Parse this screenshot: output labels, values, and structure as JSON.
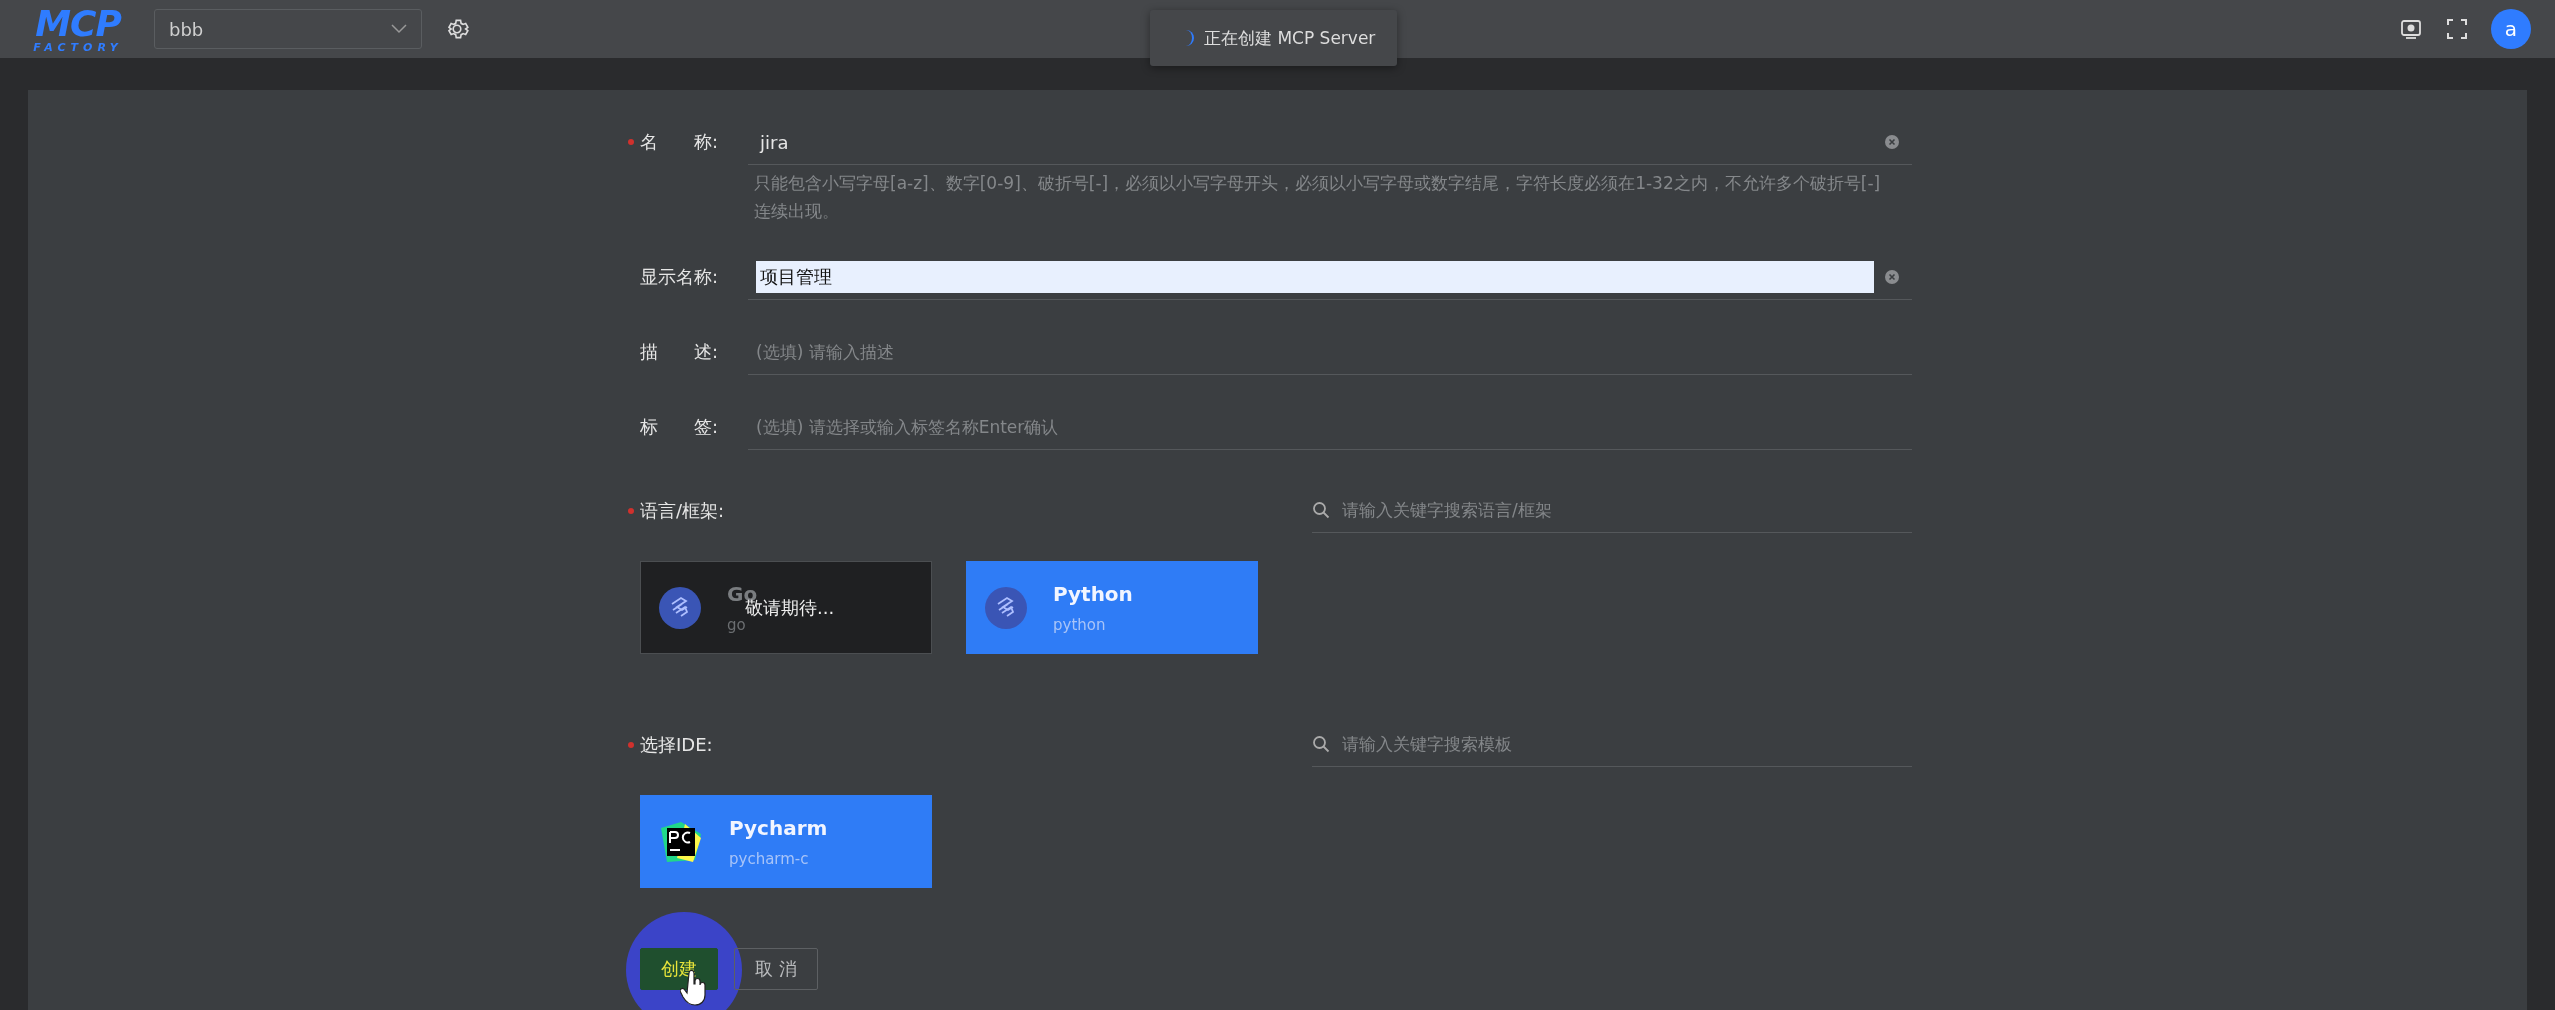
{
  "header": {
    "logo": {
      "top": "MCP",
      "bottom": "FACTORY"
    },
    "project_select": {
      "value": "bbb"
    },
    "toast": {
      "text": "正在创建 MCP Server"
    },
    "avatar": "a"
  },
  "fields": [
    {
      "label": "名　　称:",
      "required": true,
      "value": "jira",
      "highlighted": false,
      "clearable": true,
      "hint": "只能包含小写字母[a-z]、数字[0-9]、破折号[-]，必须以小写字母开头，必须以小写字母或数字结尾，字符长度必须在1-32之内，不允许多个破折号[-]连续出现。"
    },
    {
      "label": "显示名称:",
      "required": false,
      "value": "项目管理",
      "highlighted": true,
      "clearable": true
    },
    {
      "label": "描　　述:",
      "required": false,
      "placeholder": "(选填) 请输入描述",
      "clearable": false
    },
    {
      "label": "标　　签:",
      "required": false,
      "placeholder": "(选填) 请选择或输入标签名称Enter确认",
      "clearable": false
    }
  ],
  "sections": [
    {
      "label": "语言/框架:",
      "required": true,
      "search_placeholder": "请输入关键字搜索语言/框架",
      "cards": [
        {
          "kind": "framework",
          "title": "Go",
          "subtitle": "go",
          "selected": false,
          "disabled": true,
          "overlay": "敬请期待..."
        },
        {
          "kind": "framework",
          "title": "Python",
          "subtitle": "python",
          "selected": true,
          "disabled": false
        }
      ]
    },
    {
      "label": "选择IDE:",
      "required": true,
      "search_placeholder": "请输入关键字搜索模板",
      "cards": [
        {
          "kind": "pycharm",
          "title": "Pycharm",
          "subtitle": "pycharm-c",
          "selected": true,
          "disabled": false
        }
      ]
    }
  ],
  "buttons": [
    {
      "label": "创建",
      "kind": "primary",
      "clicked": true
    },
    {
      "label": "取 消",
      "kind": "default",
      "clicked": false
    }
  ]
}
